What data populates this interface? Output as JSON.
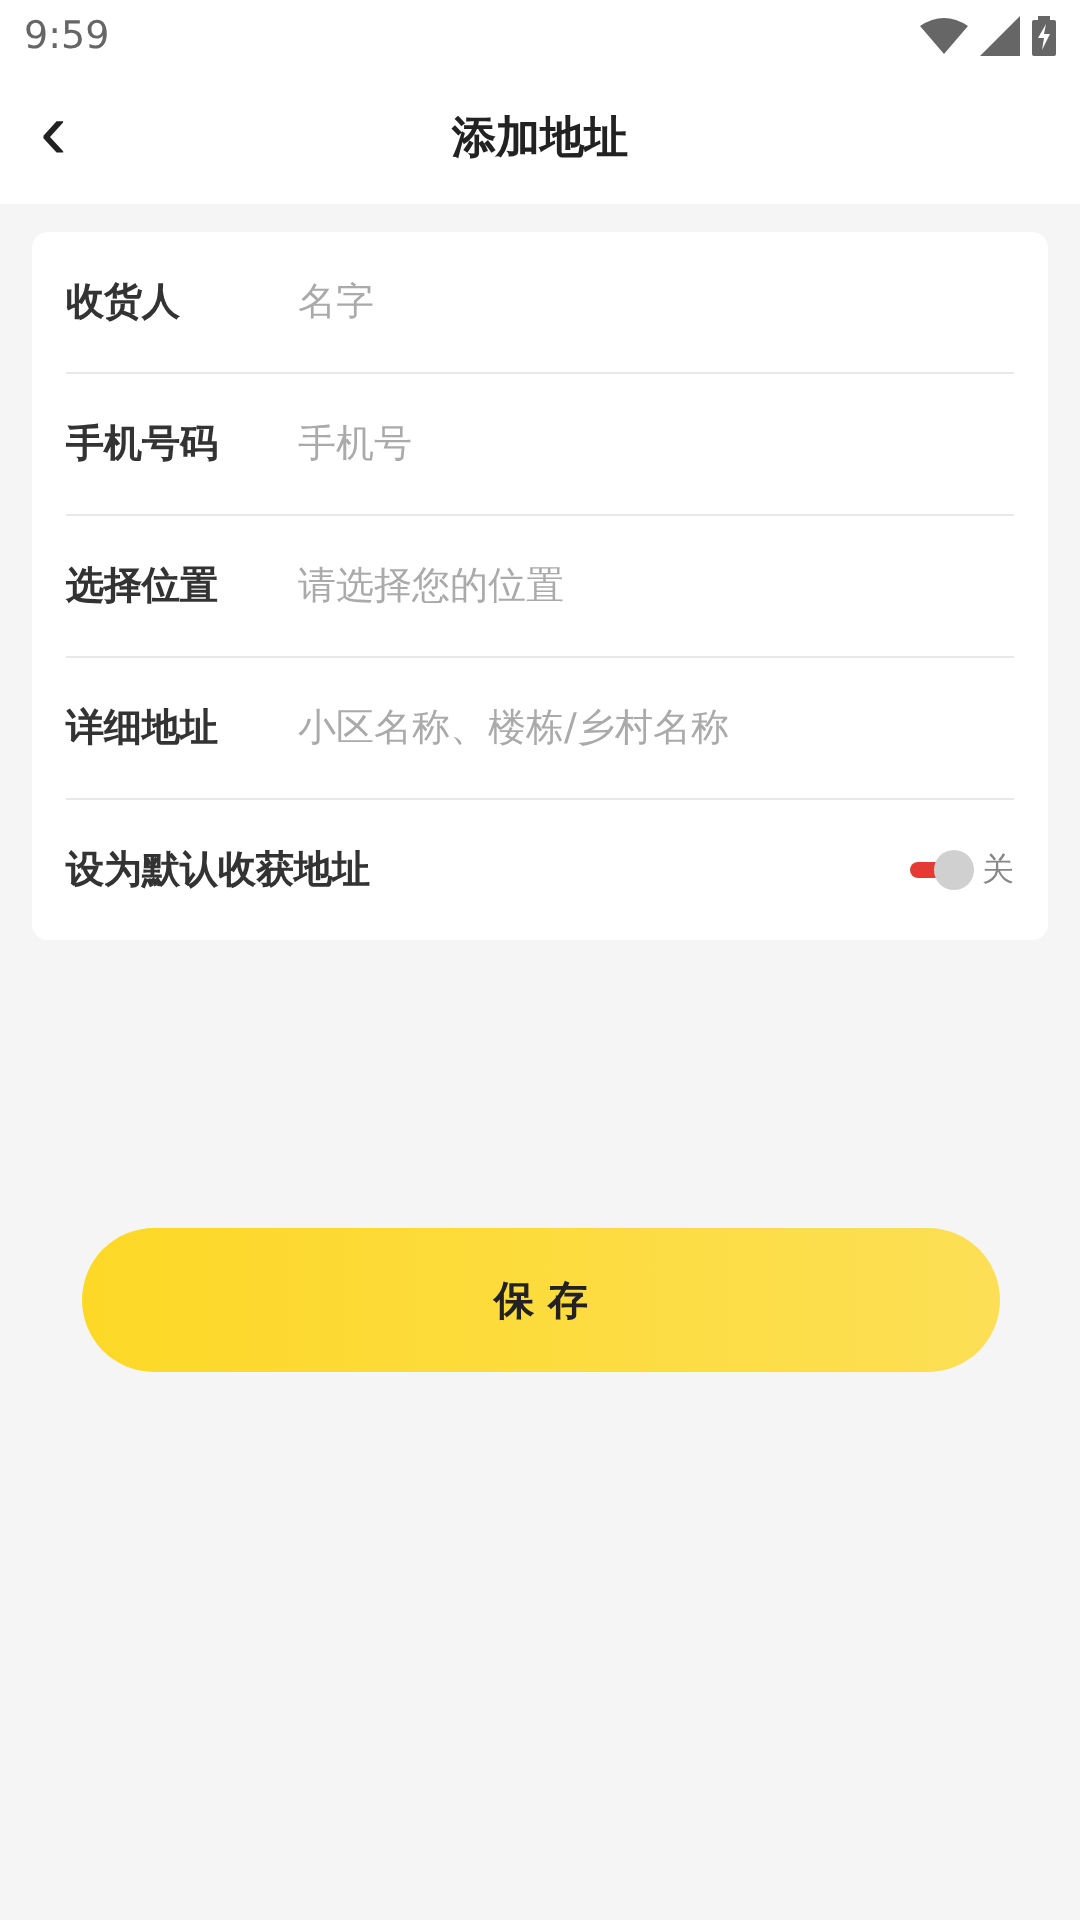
{
  "status_bar": {
    "time": "9:59"
  },
  "header": {
    "back": "‹",
    "title": "添加地址"
  },
  "fields": [
    {
      "label": "收货人",
      "placeholder": "名字"
    },
    {
      "label": "手机号码",
      "placeholder": "手机号"
    },
    {
      "label": "选择位置",
      "placeholder": "请选择您的位置"
    },
    {
      "label": "详细地址",
      "placeholder": "小区名称、楼栋/乡村名称"
    }
  ],
  "default_address": {
    "label": "设为默认收获地址",
    "on": true,
    "state_text": "关"
  },
  "save_button": "保 存"
}
